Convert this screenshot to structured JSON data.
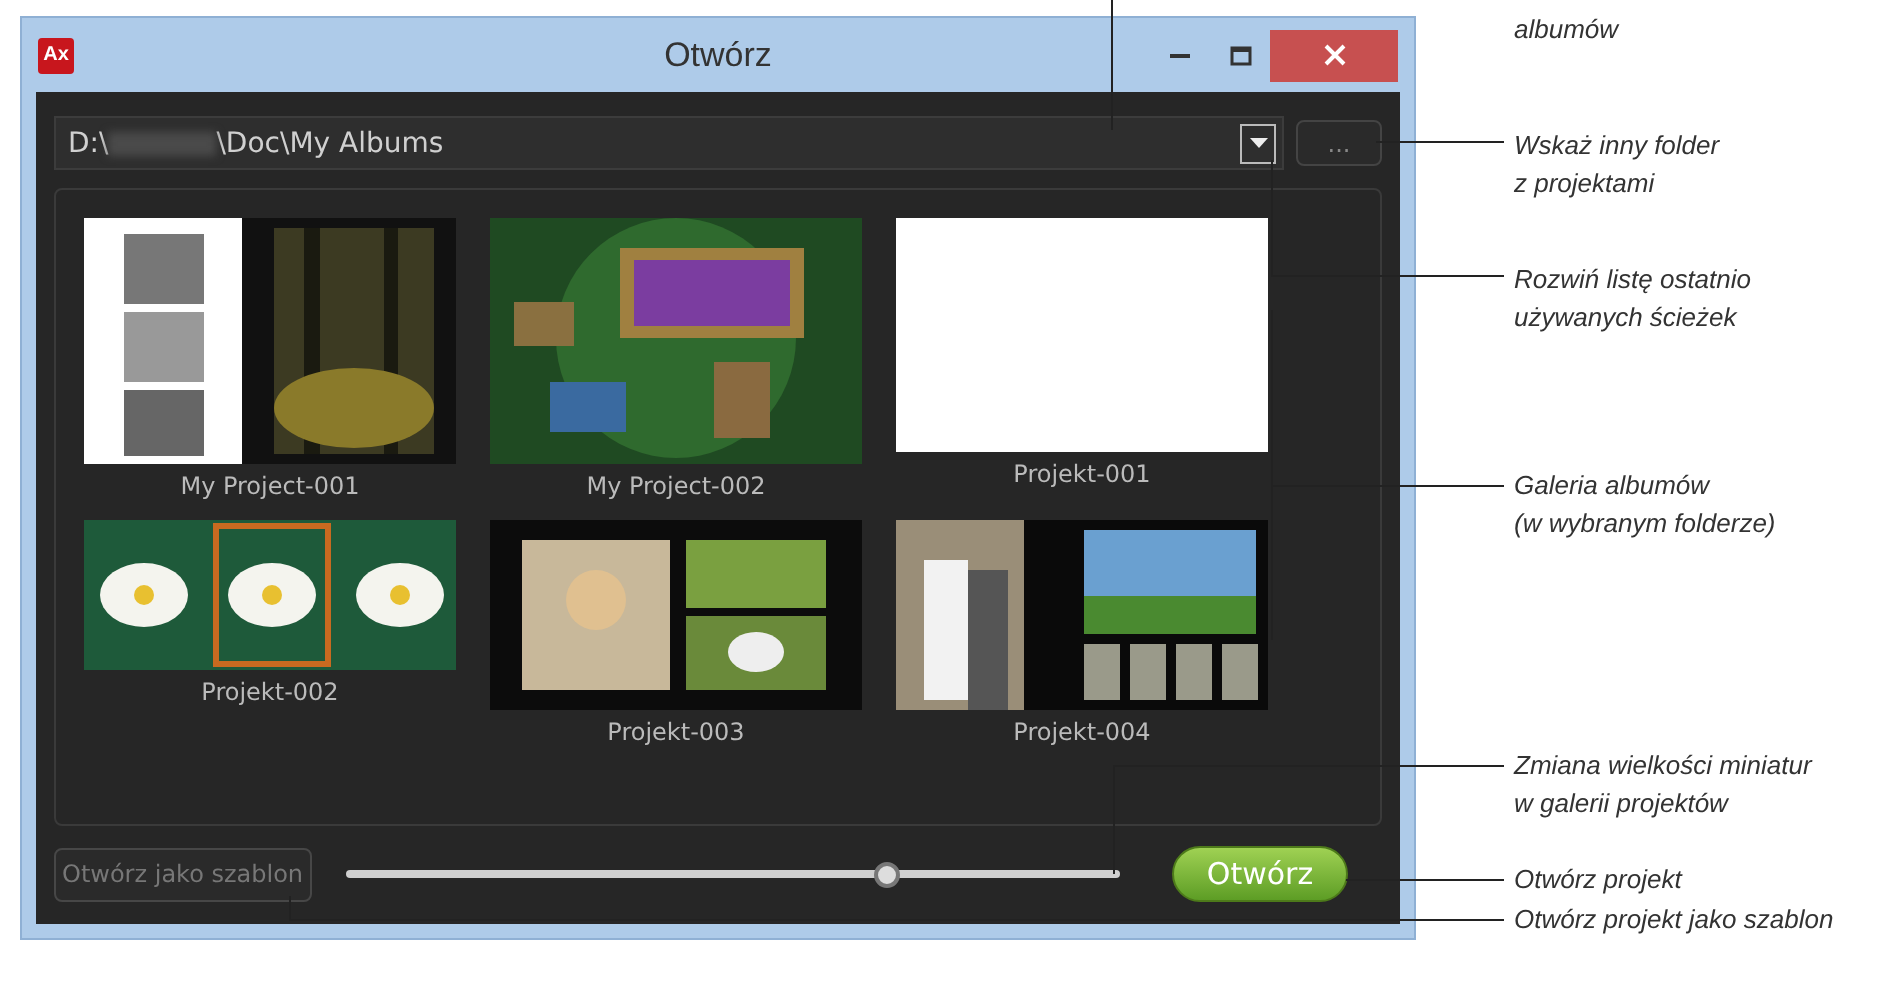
{
  "window": {
    "app_icon": "Ax",
    "title": "Otwórz"
  },
  "path": {
    "drive": "D:\\",
    "rest": "\\Doc\\My Albums"
  },
  "browse_button": "...",
  "albums": [
    {
      "name": "My Project-001",
      "kind": "picture"
    },
    {
      "name": "My Project-002",
      "kind": "picture"
    },
    {
      "name": "Projekt-001",
      "kind": "blank"
    },
    {
      "name": "Projekt-002",
      "kind": "picture"
    },
    {
      "name": "Projekt-003",
      "kind": "picture"
    },
    {
      "name": "Projekt-004",
      "kind": "picture"
    }
  ],
  "template_button": "Otwórz jako szablon",
  "thumb_size": {
    "level": 0.7
  },
  "open_button": "Otwórz",
  "callouts": [
    {
      "lines": [
        "albumów"
      ]
    },
    {
      "lines": [
        "Wskaż inny folder",
        "z projektami"
      ]
    },
    {
      "lines": [
        "Rozwiń listę ostatnio",
        "używanych ścieżek"
      ]
    },
    {
      "lines": [
        "Galeria albumów",
        "(w wybranym folderze)"
      ]
    },
    {
      "lines": [
        "Zmiana wielkości miniatur",
        "w galerii projektów"
      ]
    },
    {
      "lines": [
        "Otwórz projekt"
      ]
    },
    {
      "lines": [
        "Otwórz projekt jako szablon"
      ]
    }
  ]
}
